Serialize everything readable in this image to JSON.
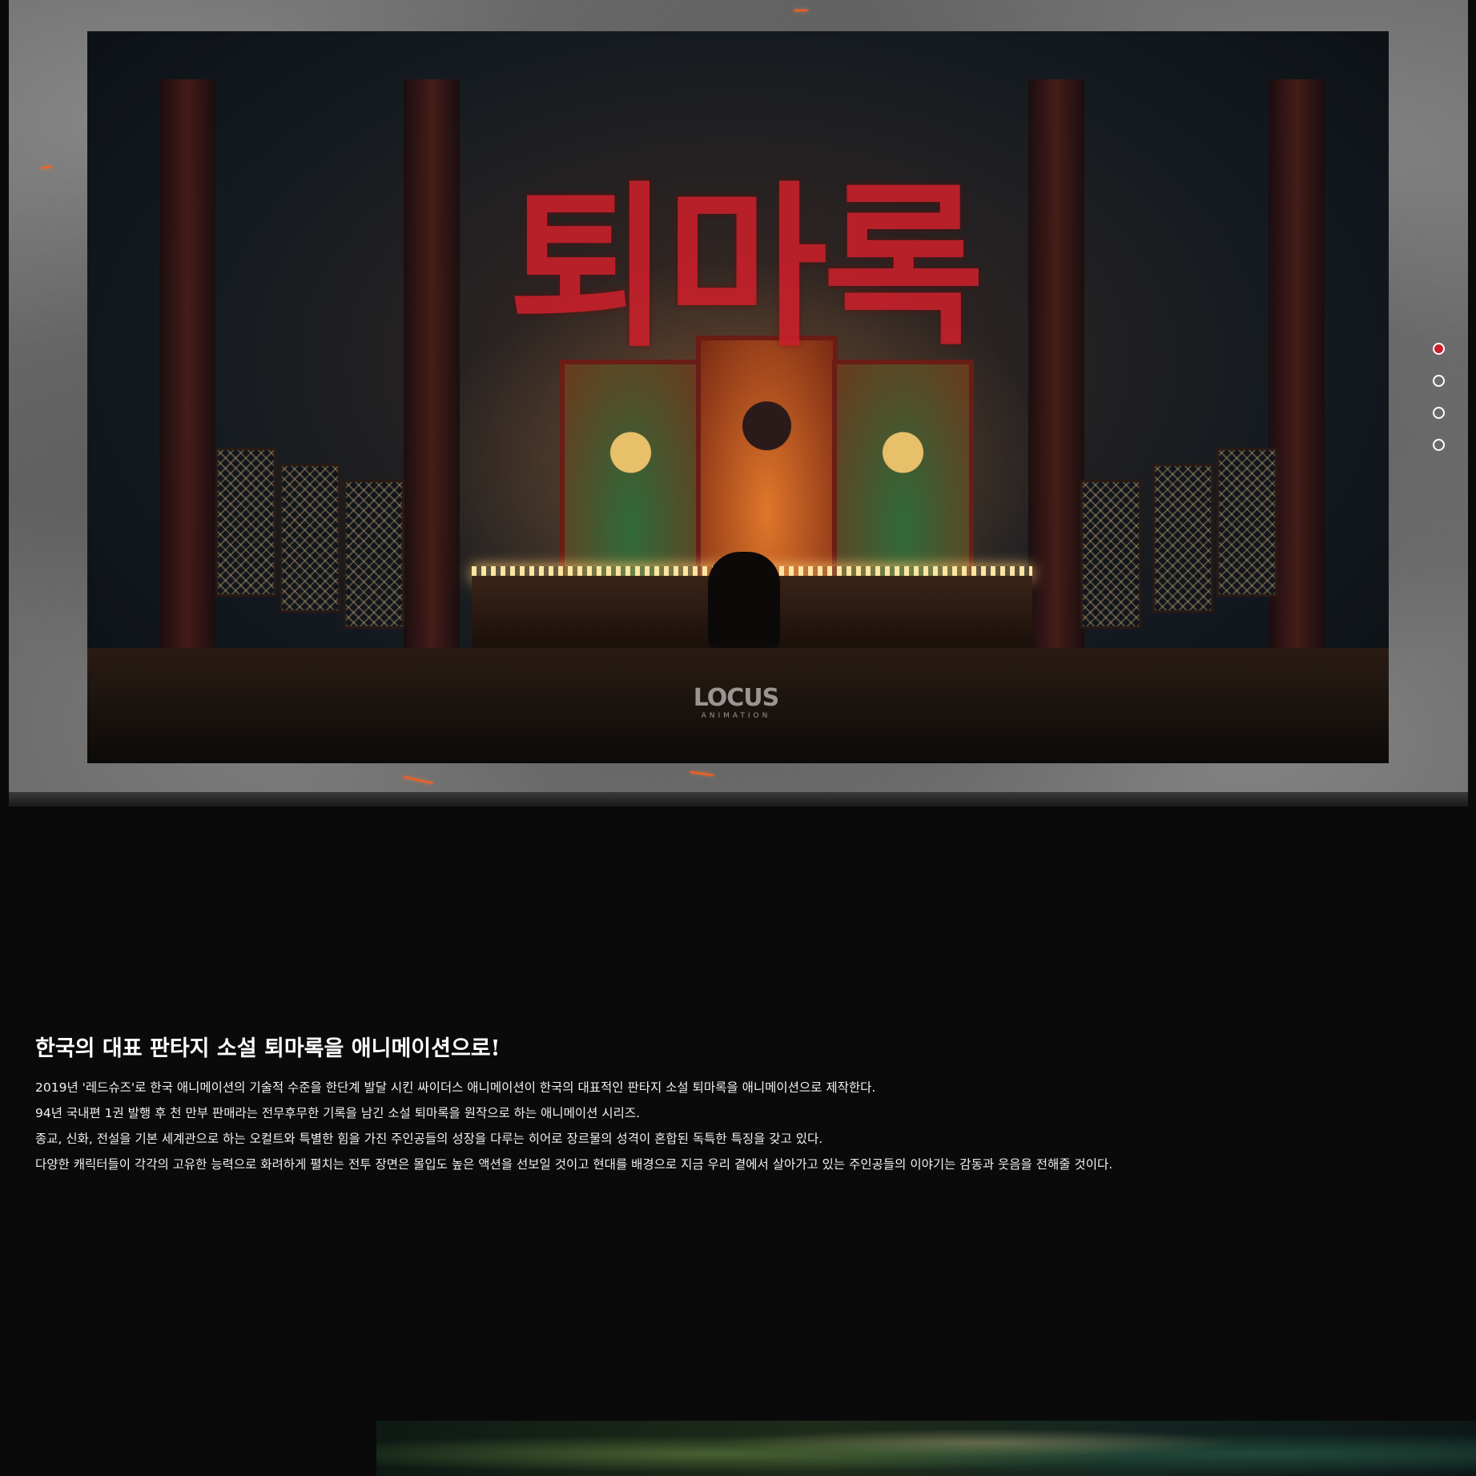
{
  "hero": {
    "title_logo": "퇴마록",
    "studio_logo": {
      "name": "LOCUS",
      "sub": "ANIMATION"
    },
    "pagination": {
      "total": 4,
      "active_index": 0,
      "active_color": "#c8202a"
    }
  },
  "intro": {
    "title": "한국의 대표 판타지 소설 퇴마록을 애니메이션으로!",
    "lines": [
      "2019년 '레드슈즈'로 한국 애니메이션의 기술적 수준을 한단계 발달 시킨 싸이더스 애니메이션이 한국의 대표적인 판타지 소설 퇴마록을 애니메이션으로 제작한다.",
      "94년 국내편 1권 발행 후 천 만부 판매라는 전무후무한 기록을 남긴 소설 퇴마록을 원작으로 하는 애니메이션 시리즈.",
      "종교, 신화, 전설을 기본 세계관으로 하는 오컬트와 특별한 힘을 가진 주인공들의 성장을 다루는 히어로 장르물의 성격이 혼합된 독특한 특징을 갖고 있다.",
      "다양한 캐릭터들이 각각의 고유한 능력으로 화려하게 펼치는 전투 장면은 몰입도 높은 액션을 선보일 것이고 현대를 배경으로 지금 우리 곁에서 살아가고 있는 주인공들의 이야기는 감동과 웃음을 전해줄 것이다."
    ]
  }
}
